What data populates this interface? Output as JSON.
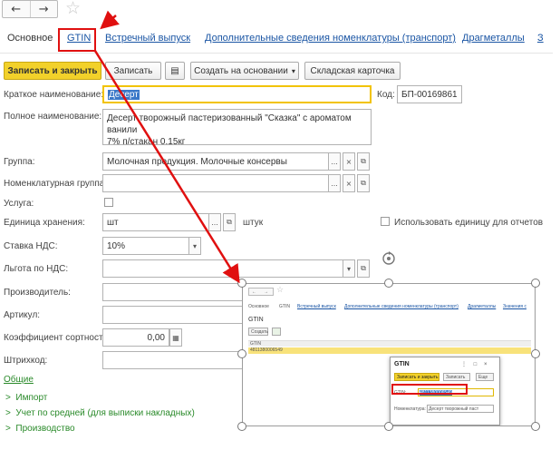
{
  "nav": {
    "back_icon": "←",
    "forward_icon": "→",
    "star_icon": "☆"
  },
  "tabs": [
    {
      "label": "Основное"
    },
    {
      "label": "GTIN"
    },
    {
      "label": "Встречный выпуск"
    },
    {
      "label": "Дополнительные сведения номенклатуры (транспорт)"
    },
    {
      "label": "Драгметаллы"
    },
    {
      "label": "З"
    }
  ],
  "toolbar": {
    "save_close": "Записать и закрыть",
    "save": "Записать",
    "report_icon": "▤",
    "create_basis": "Создать на основании",
    "dropdown_arrow": "▾",
    "stock_card": "Складская карточка"
  },
  "form": {
    "short_name_label": "Краткое наименование:",
    "short_name_value": "Десерт",
    "code_label": "Код:",
    "code_value": "БП-00169861",
    "full_name_label": "Полное наименование:",
    "full_name_value_1": "Десерт творожный пастеризованный \"Сказка\" с ароматом ванили",
    "full_name_value_2": "7% п/стакан 0,15кг",
    "group_label": "Группа:",
    "group_value": "Молочная продукция. Молочные консервы",
    "nomgroup_label": "Номенклатурная группа:",
    "service_label": "Услуга:",
    "unit_label": "Единица хранения:",
    "unit_value": "шт",
    "unit_name": "штук",
    "use_unit_label": "Использовать единицу для отчетов",
    "vat_label": "Ставка НДС:",
    "vat_value": "10%",
    "vat_benefit_label": "Льгота по НДС:",
    "producer_label": "Производитель:",
    "article_label": "Артикул:",
    "grade_coef_label": "Коэффициент сортности:",
    "grade_coef_value": "0,00",
    "barcode_label": "Штрихкод:",
    "general_link": "Общие",
    "sections": [
      "Импорт",
      "Учет по средней (для выписки накладных)",
      "Производство"
    ],
    "section_arrow": ">",
    "dots": "...",
    "clear": "×",
    "copy": "⧉",
    "calc_icon": "▦"
  },
  "inset": {
    "tabs": [
      "Основное",
      "GTIN",
      "Встречный выпуск",
      "Дополнительные сведения номенклатуры (транспорт)",
      "Драгметаллы",
      "Значения с"
    ],
    "title": "GTIN",
    "create": "Создать",
    "col_header": "GTIN",
    "row_value": "4811380006549",
    "dialog_title": "GTIN",
    "dialog_save_close": "Записать и закрыть",
    "dialog_save": "Записать",
    "dialog_more": "Еще",
    "dialog_gtin_label": "GTIN:",
    "dialog_gtin_value": "4811380006549",
    "dialog_nom_label": "Номенклатура:",
    "dialog_nom_value": "Десерт творожный паст"
  },
  "colors": {
    "accent_yellow": "#f2d12a",
    "link_blue": "#1a55a4",
    "highlight_red": "#e01010",
    "green": "#2a8a2a"
  }
}
